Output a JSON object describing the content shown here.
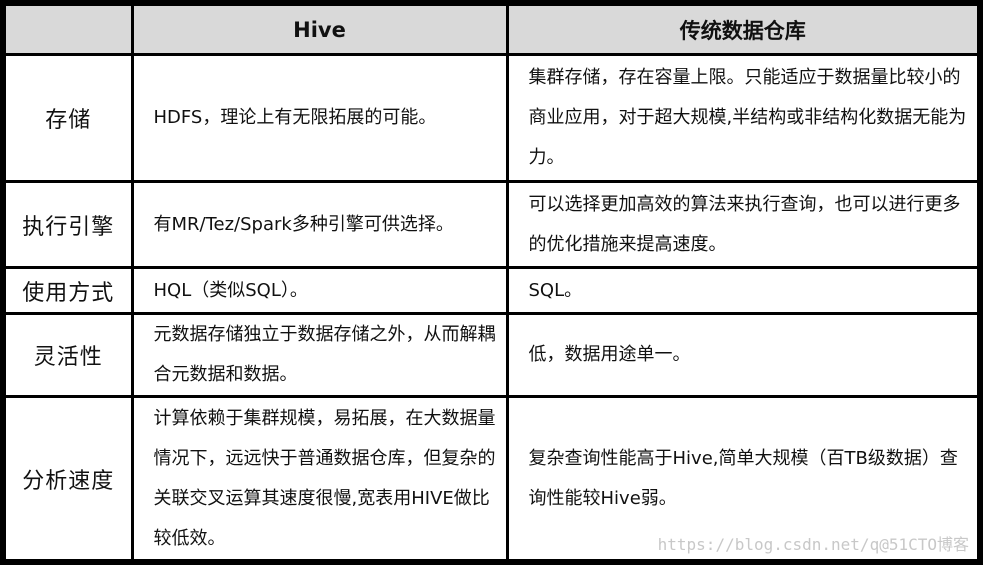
{
  "table": {
    "headers": [
      "",
      "Hive",
      "传统数据仓库"
    ],
    "rows": [
      {
        "label": "存储",
        "hive": "HDFS，理论上有无限拓展的可能。",
        "traditional": "集群存储，存在容量上限。只能适应于数据量比较小的商业应用，对于超大规模,半结构或非结构化数据无能为力。"
      },
      {
        "label": "执行引擎",
        "hive": "有MR/Tez/Spark多种引擎可供选择。",
        "traditional": "可以选择更加高效的算法来执行查询，也可以进行更多的优化措施来提高速度。"
      },
      {
        "label": "使用方式",
        "hive": "HQL（类似SQL）。",
        "traditional": "SQL。"
      },
      {
        "label": "灵活性",
        "hive": "元数据存储独立于数据存储之外，从而解耦合元数据和数据。",
        "traditional": "低，数据用途单一。"
      },
      {
        "label": "分析速度",
        "hive": "计算依赖于集群规模，易拓展，在大数据量情况下，远远快于普通数据仓库，但复杂的关联交叉运算其速度很慢,宽表用HIVE做比较低效。",
        "traditional": "复杂查询性能高于Hive,简单大规模（百TB级数据）查询性能较Hive弱。"
      }
    ]
  },
  "watermark": "https://blog.csdn.net/q@51CTO博客"
}
